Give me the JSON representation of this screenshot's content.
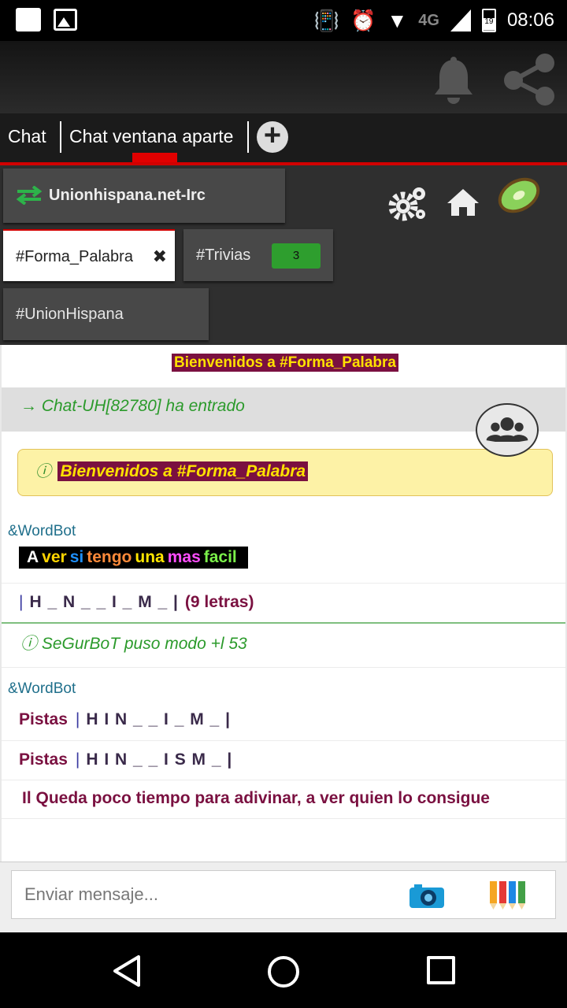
{
  "status_bar": {
    "time": "08:06",
    "network": "4G",
    "battery": "19"
  },
  "tabs": {
    "chat": "Chat",
    "window": "Chat ventana aparte"
  },
  "network": {
    "name": "Unionhispana.net-Irc"
  },
  "channels": [
    {
      "name": "#Forma_Palabra",
      "close": "✖"
    },
    {
      "name": "#Trivias",
      "badge": "3"
    },
    {
      "name": "#UnionHispana"
    }
  ],
  "messages": {
    "topic": "Bienvenidos a #Forma_Palabra",
    "join": "→ Chat-UH[82780] ha entrado",
    "notice_icon": "ⓘ",
    "notice": "Bienvenidos a #Forma_Palabra",
    "nick1": "&WordBot",
    "rainbow": [
      "A",
      "ver",
      "si",
      "tengo",
      "una",
      "mas",
      "facil"
    ],
    "bar": "|",
    "pattern1": "H _ N _ _ I _ M _ |",
    "letras": "(9 letras)",
    "mode": "ⓘ SeGurBoT puso modo +l 53",
    "nick2": "&WordBot",
    "pistas_label": "Pistas",
    "pista1": "H I N _ _ I _ M _ |",
    "pista2": "H I N _ _ I S M _ |",
    "warning": "Il Queda poco tiempo para adivinar, a ver quien lo consigue"
  },
  "input": {
    "placeholder": "Enviar mensaje..."
  },
  "colors": {
    "accent": "#d10000",
    "highlight_bg": "#7a1040",
    "highlight_fg": "#ffe100",
    "green": "#2b9a2b"
  }
}
